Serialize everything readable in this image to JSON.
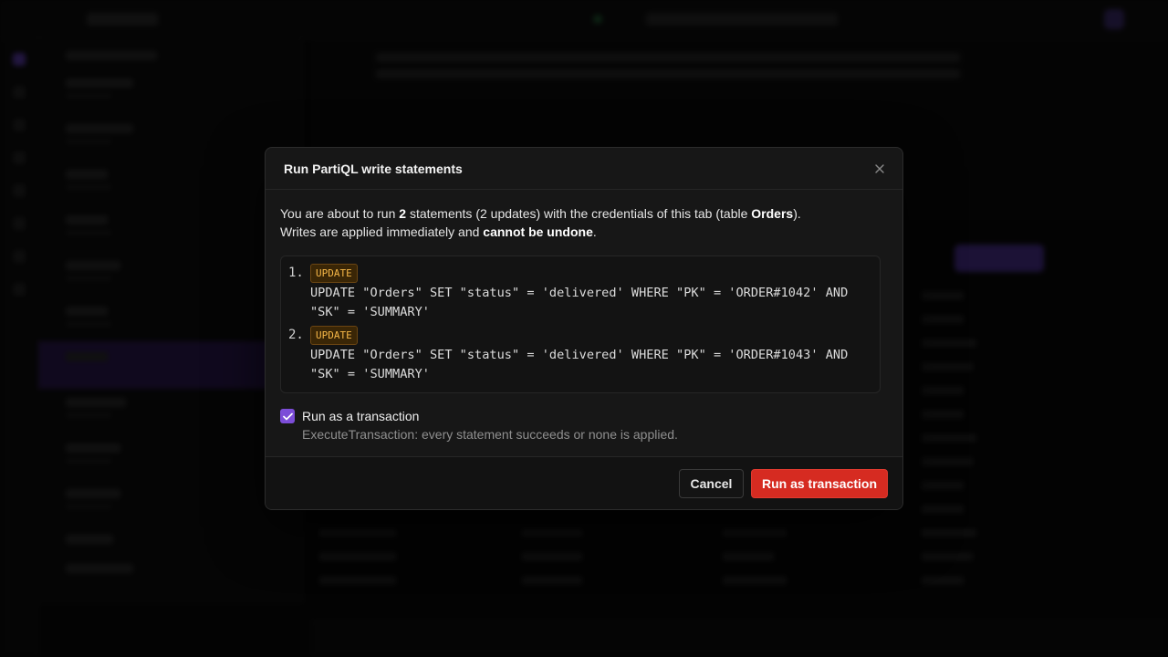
{
  "dialog": {
    "title": "Run PartiQL write statements",
    "intro_1": "You are about to run ",
    "intro_count": "2",
    "intro_2": " statements (2 updates) with the credentials of this tab (table ",
    "intro_table": "Orders",
    "intro_3": ").",
    "intro_4": "Writes are applied immediately and ",
    "intro_warning": "cannot be undone",
    "intro_5": ".",
    "statements": [
      {
        "number": "1.",
        "type": "UPDATE",
        "sql": "UPDATE \"Orders\" SET \"status\" = 'delivered' WHERE \"PK\" = 'ORDER#1042' AND \"SK\" = 'SUMMARY'"
      },
      {
        "number": "2.",
        "type": "UPDATE",
        "sql": "UPDATE \"Orders\" SET \"status\" = 'delivered' WHERE \"PK\" = 'ORDER#1043' AND \"SK\" = 'SUMMARY'"
      }
    ],
    "transaction": {
      "checked": true,
      "label": "Run as a transaction",
      "description": "ExecuteTransaction: every statement succeeds or none is applied."
    },
    "cancel_label": "Cancel",
    "run_label": "Run as transaction"
  },
  "icons": {
    "close": "close-icon",
    "check": "check-icon"
  },
  "colors": {
    "accent": "#7c4dd8",
    "danger": "#d62b21",
    "badge_text": "#f5b647"
  }
}
